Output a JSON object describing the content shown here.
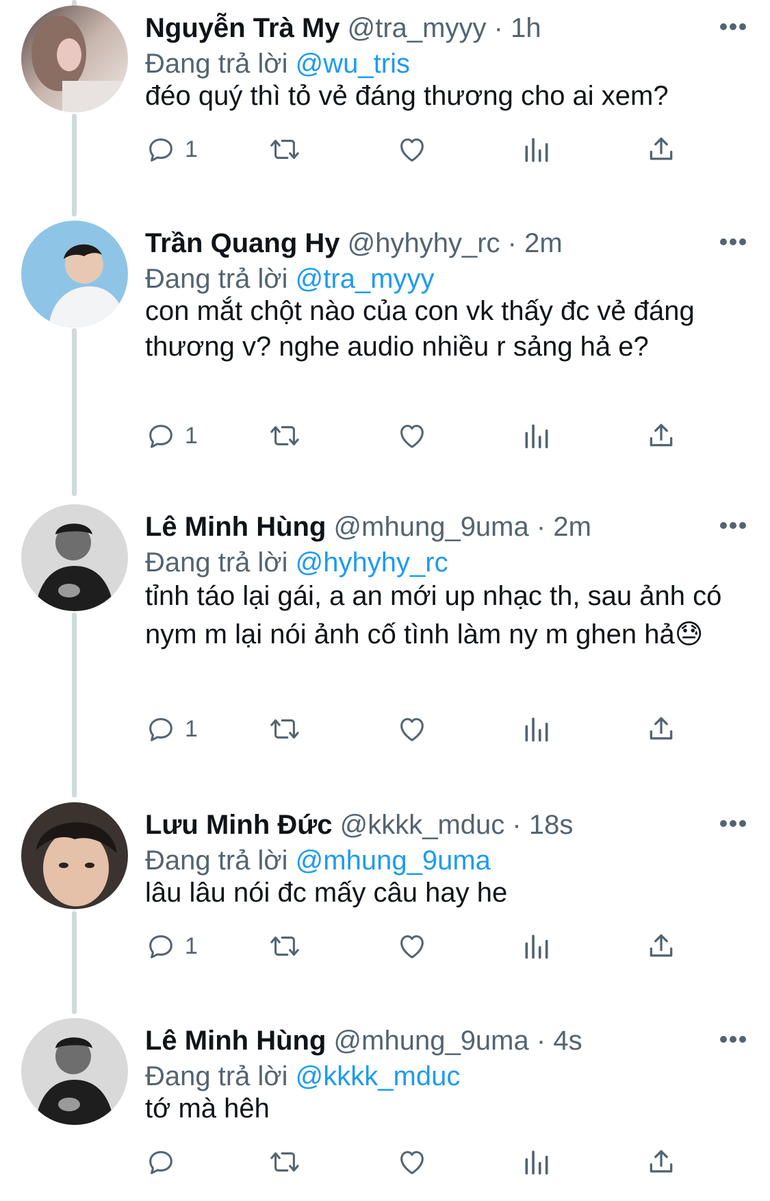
{
  "replying_prefix": "Đang trả lời",
  "tweets": [
    {
      "name": "Nguyễn Trà My",
      "handle": "@tra_myyy",
      "time": "1h",
      "reply_to": "@wu_tris",
      "text": "đéo quý thì tỏ vẻ đáng thương cho ai xem?",
      "reply_count": "1",
      "avatar_icon": "avatar-photo"
    },
    {
      "name": "Trần Quang Hy",
      "handle": "@hyhyhy_rc",
      "time": "2m",
      "reply_to": "@tra_myyy",
      "text": "con mắt chột nào của con vk thấy đc vẻ đáng thương v? nghe audio nhiều r sảng hả e?",
      "reply_count": "1",
      "avatar_icon": "avatar-photo"
    },
    {
      "name": "Lê Minh Hùng",
      "handle": "@mhung_9uma",
      "time": "2m",
      "reply_to": "@hyhyhy_rc",
      "text": "tỉnh táo lại gái, a an mới up nhạc th, sau ảnh có nym m lại nói ảnh cố tình làm ny m ghen hả😓",
      "reply_count": "1",
      "avatar_icon": "avatar-photo"
    },
    {
      "name": "Lưu Minh Đức",
      "handle": "@kkkk_mduc",
      "time": "18s",
      "reply_to": "@mhung_9uma",
      "text": "lâu lâu nói đc mấy câu hay he",
      "reply_count": "1",
      "avatar_icon": "avatar-photo"
    },
    {
      "name": "Lê Minh Hùng",
      "handle": "@mhung_9uma",
      "time": "4s",
      "reply_to": "@kkkk_mduc",
      "text": "tớ mà hêh",
      "reply_count": "",
      "avatar_icon": "avatar-photo"
    }
  ],
  "separator": "·",
  "icons": {
    "reply": "reply-icon",
    "retweet": "retweet-icon",
    "like": "heart-icon",
    "stats": "analytics-icon",
    "share": "share-icon",
    "more": "more-icon"
  },
  "colors": {
    "mention": "#1d9bf0",
    "secondary_text": "#536471",
    "primary_text": "#0f1419",
    "thread_line": "#cfd9de"
  }
}
